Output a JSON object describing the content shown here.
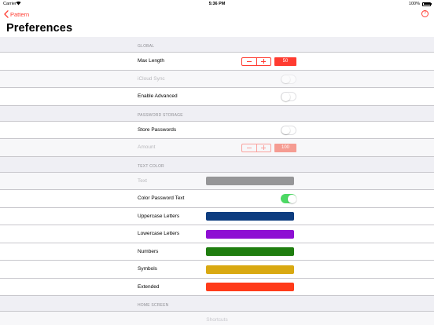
{
  "status_bar": {
    "carrier": "Carrier",
    "time": "5:36 PM",
    "battery": "100%"
  },
  "navbar": {
    "back_label": "Pattern",
    "help_glyph": "?",
    "title": "Preferences"
  },
  "sections": {
    "global": {
      "header": "GLOBAL",
      "max_length": {
        "label": "Max Length",
        "value": "50"
      },
      "icloud_sync": {
        "label": "iCloud Sync",
        "on": false
      },
      "enable_advanced": {
        "label": "Enable Advanced",
        "on": false
      }
    },
    "password_storage": {
      "header": "PASSWORD STORAGE",
      "store_passwords": {
        "label": "Store Passwords",
        "on": false
      },
      "amount": {
        "label": "Amount",
        "value": "100"
      }
    },
    "text_color": {
      "header": "TEXT COLOR",
      "text": {
        "label": "Text",
        "color": "#7d7d80"
      },
      "color_password_text": {
        "label": "Color Password Text",
        "on": true
      },
      "uppercase": {
        "label": "Uppercase Letters",
        "color": "#0e3d80"
      },
      "lowercase": {
        "label": "Lowercase Letters",
        "color": "#8e0fd3"
      },
      "numbers": {
        "label": "Numbers",
        "color": "#1f7d0f"
      },
      "symbols": {
        "label": "Symbols",
        "color": "#d9a912"
      },
      "extended": {
        "label": "Extended",
        "color": "#ff3b1a"
      }
    },
    "home_screen": {
      "header": "HOME SCREEN",
      "shortcuts": {
        "label": "Shortcuts"
      }
    }
  },
  "colors": {
    "accent": "#ff3b30",
    "switch_on": "#4cd964"
  }
}
